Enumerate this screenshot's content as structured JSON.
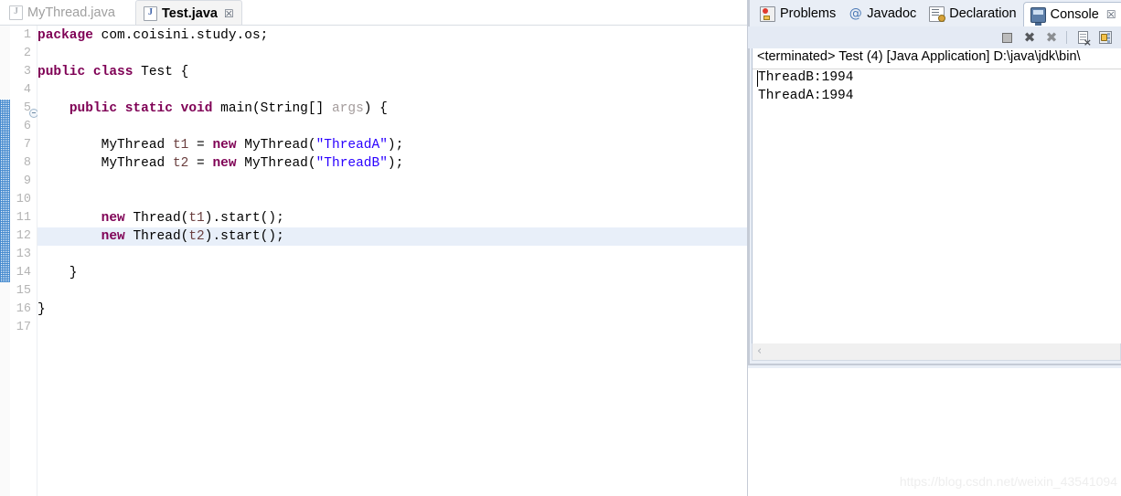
{
  "editor": {
    "tabs": [
      {
        "label": "MyThread.java",
        "icon": "java-file-icon",
        "active": false,
        "closable": false
      },
      {
        "label": "Test.java",
        "icon": "java-file-icon",
        "active": true,
        "closable": true,
        "close_glyph": "☒"
      }
    ],
    "caret_line": 12,
    "fold_marker_line": 5,
    "fold_region": {
      "from_line": 5,
      "to_line": 14
    },
    "line_numbers": [
      "1",
      "2",
      "3",
      "4",
      "5",
      "6",
      "7",
      "8",
      "9",
      "10",
      "11",
      "12",
      "13",
      "14",
      "15",
      "16",
      "17"
    ],
    "lines": [
      {
        "n": 1,
        "tokens": [
          {
            "t": "package ",
            "c": "kw"
          },
          {
            "t": "com.coisini.study.os;",
            "c": "plain"
          }
        ]
      },
      {
        "n": 2,
        "tokens": []
      },
      {
        "n": 3,
        "tokens": [
          {
            "t": "public class ",
            "c": "kw"
          },
          {
            "t": "Test {",
            "c": "plain"
          }
        ]
      },
      {
        "n": 4,
        "tokens": []
      },
      {
        "n": 5,
        "tokens": [
          {
            "t": "    ",
            "c": "plain"
          },
          {
            "t": "public static void ",
            "c": "kw"
          },
          {
            "t": "main(String[] ",
            "c": "plain"
          },
          {
            "t": "args",
            "c": "parm"
          },
          {
            "t": ") {",
            "c": "plain"
          }
        ]
      },
      {
        "n": 6,
        "tokens": []
      },
      {
        "n": 7,
        "tokens": [
          {
            "t": "        MyThread ",
            "c": "plain"
          },
          {
            "t": "t1",
            "c": "lvar"
          },
          {
            "t": " = ",
            "c": "plain"
          },
          {
            "t": "new ",
            "c": "kw"
          },
          {
            "t": "MyThread(",
            "c": "plain"
          },
          {
            "t": "\"ThreadA\"",
            "c": "str"
          },
          {
            "t": ");",
            "c": "plain"
          }
        ]
      },
      {
        "n": 8,
        "tokens": [
          {
            "t": "        MyThread ",
            "c": "plain"
          },
          {
            "t": "t2",
            "c": "lvar"
          },
          {
            "t": " = ",
            "c": "plain"
          },
          {
            "t": "new ",
            "c": "kw"
          },
          {
            "t": "MyThread(",
            "c": "plain"
          },
          {
            "t": "\"ThreadB\"",
            "c": "str"
          },
          {
            "t": ");",
            "c": "plain"
          }
        ]
      },
      {
        "n": 9,
        "tokens": []
      },
      {
        "n": 10,
        "tokens": []
      },
      {
        "n": 11,
        "tokens": [
          {
            "t": "        ",
            "c": "plain"
          },
          {
            "t": "new ",
            "c": "kw"
          },
          {
            "t": "Thread(",
            "c": "plain"
          },
          {
            "t": "t1",
            "c": "lvar"
          },
          {
            "t": ").start();",
            "c": "plain"
          }
        ]
      },
      {
        "n": 12,
        "tokens": [
          {
            "t": "        ",
            "c": "plain"
          },
          {
            "t": "new ",
            "c": "kw"
          },
          {
            "t": "Thread(",
            "c": "plain"
          },
          {
            "t": "t2",
            "c": "lvar"
          },
          {
            "t": ").start();",
            "c": "plain"
          }
        ]
      },
      {
        "n": 13,
        "tokens": []
      },
      {
        "n": 14,
        "tokens": [
          {
            "t": "    }",
            "c": "plain"
          }
        ]
      },
      {
        "n": 15,
        "tokens": []
      },
      {
        "n": 16,
        "tokens": [
          {
            "t": "}",
            "c": "plain"
          }
        ]
      },
      {
        "n": 17,
        "tokens": []
      }
    ],
    "colors": {
      "keyword": "#7f0055",
      "string": "#2a00ff",
      "local_variable": "#6a3e3e",
      "parameter": "#a59d9d",
      "caret_line_highlight": "#e8eff9",
      "line_number": "#b4b4b4",
      "fold_region": "#2878c8"
    }
  },
  "console_view": {
    "tabs": [
      {
        "label": "Problems",
        "icon": "problems-icon",
        "active": false,
        "closable": false
      },
      {
        "label": "Javadoc",
        "icon": "javadoc-icon",
        "active": false,
        "closable": false
      },
      {
        "label": "Declaration",
        "icon": "declaration-icon",
        "active": false,
        "closable": false
      },
      {
        "label": "Console",
        "icon": "console-icon",
        "active": true,
        "closable": true,
        "close_glyph": "☒"
      }
    ],
    "toolbar": [
      {
        "name": "terminate-button",
        "title": "Terminate"
      },
      {
        "name": "remove-launch-button",
        "title": "Remove Launch"
      },
      {
        "name": "remove-all-launches-button",
        "title": "Remove All Terminated Launches"
      },
      {
        "name": "clear-console-button",
        "title": "Clear Console"
      },
      {
        "name": "scroll-lock-button",
        "title": "Scroll Lock"
      }
    ],
    "header": "<terminated> Test (4) [Java Application] D:\\java\\jdk\\bin\\",
    "output_lines": [
      "ThreadB:1994",
      "ThreadA:1994"
    ],
    "scrollbar": {
      "left_arrow_glyph": "‹"
    }
  },
  "watermark": "https://blog.csdn.net/weixin_43541094"
}
